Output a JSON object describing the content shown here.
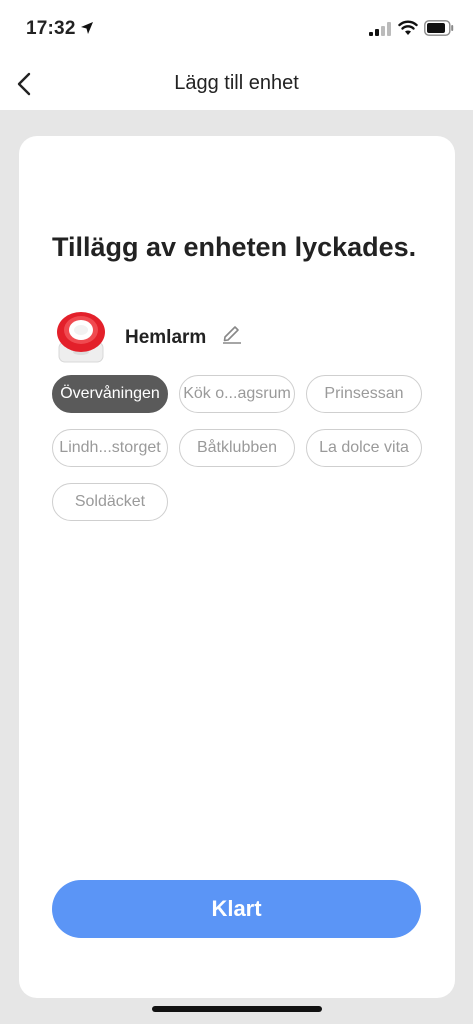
{
  "status_bar": {
    "time": "17:32",
    "icons": [
      "location-arrow-icon",
      "cellular-signal-icon",
      "wifi-icon",
      "battery-icon"
    ]
  },
  "nav": {
    "title": "Lägg till enhet",
    "back_icon": "chevron-left-icon"
  },
  "card": {
    "title": "Tillägg av enheten lyckades.",
    "device": {
      "name": "Hemlarm",
      "image": "siren-alarm-device",
      "edit_icon": "pencil-icon"
    },
    "rooms": [
      {
        "label": "Övervåningen",
        "selected": true
      },
      {
        "label": "Kök o...agsrum",
        "selected": false
      },
      {
        "label": "Prinsessan",
        "selected": false
      },
      {
        "label": "Lindh...storget",
        "selected": false
      },
      {
        "label": "Båtklubben",
        "selected": false
      },
      {
        "label": "La dolce vita",
        "selected": false
      },
      {
        "label": "Soldäcket",
        "selected": false
      }
    ],
    "done_label": "Klart"
  },
  "colors": {
    "accent": "#5b95f6",
    "chip_selected": "#5a5a5a",
    "chip_border": "#cfcfcf",
    "background": "#e6e6e6"
  }
}
